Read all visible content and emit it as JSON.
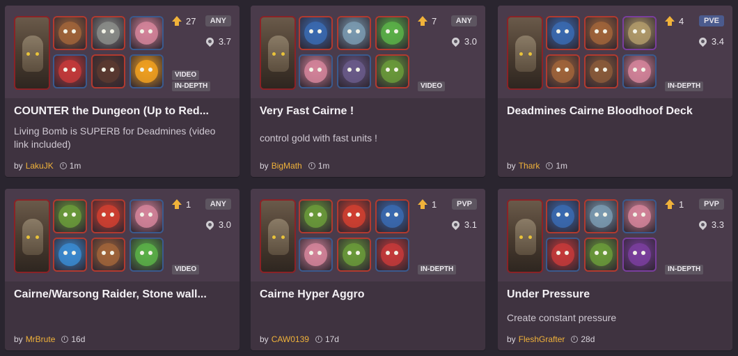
{
  "by_label": "by",
  "cards": [
    {
      "votes": "27",
      "mode": "ANY",
      "elixir": "3.7",
      "tags": [
        "VIDEO",
        "IN-DEPTH"
      ],
      "title": "COUNTER the Dungeon (Up to Red...",
      "description": "Living Bomb is SUPERB for Deadmines (video link included)",
      "author": "LakuJK",
      "age": "1m",
      "units": [
        {
          "name": "ogre-minion",
          "color": "#a0643a",
          "frame": "red"
        },
        {
          "name": "worgen",
          "color": "#8a8c88",
          "frame": "red"
        },
        {
          "name": "pirate-girl",
          "color": "#d4849a",
          "frame": "blue"
        },
        {
          "name": "red-ogre",
          "color": "#c43a3a",
          "frame": "blue"
        },
        {
          "name": "whelp",
          "color": "#5a3a30",
          "frame": "red"
        },
        {
          "name": "fire-elemental",
          "color": "#f0a020",
          "frame": "blue"
        }
      ]
    },
    {
      "votes": "7",
      "mode": "ANY",
      "elixir": "3.0",
      "tags": [
        "VIDEO"
      ],
      "title": "Very Fast Cairne !",
      "description": "control gold with fast units !",
      "author": "BigMath",
      "age": "1m",
      "units": [
        {
          "name": "blue-troll",
          "color": "#3a6ab0",
          "frame": "red"
        },
        {
          "name": "stone-golem",
          "color": "#7a9ab0",
          "frame": "red"
        },
        {
          "name": "murloc",
          "color": "#5ab048",
          "frame": "red"
        },
        {
          "name": "pirate-girl",
          "color": "#d4849a",
          "frame": "blue"
        },
        {
          "name": "bomb",
          "color": "#6a5a8a",
          "frame": "blue"
        },
        {
          "name": "ghoul",
          "color": "#6a9a3a",
          "frame": "red"
        }
      ]
    },
    {
      "votes": "4",
      "mode": "PVE",
      "elixir": "3.4",
      "tags": [
        "IN-DEPTH"
      ],
      "title": "Deadmines Cairne Bloodhoof Deck",
      "description": "",
      "author": "Thark",
      "age": "1m",
      "units": [
        {
          "name": "blue-troll",
          "color": "#3a6ab0",
          "frame": "red"
        },
        {
          "name": "ogre-minion",
          "color": "#a0643a",
          "frame": "red"
        },
        {
          "name": "bone-dwarf",
          "color": "#b09a6a",
          "frame": "purple"
        },
        {
          "name": "rock-golem",
          "color": "#a0643a",
          "frame": "red"
        },
        {
          "name": "boar",
          "color": "#8a5a3a",
          "frame": "red"
        },
        {
          "name": "pirate-girl",
          "color": "#d4849a",
          "frame": "blue"
        }
      ]
    },
    {
      "votes": "1",
      "mode": "ANY",
      "elixir": "3.0",
      "tags": [
        "VIDEO"
      ],
      "title": "Cairne/Warsong Raider, Stone wall...",
      "description": "",
      "author": "MrBrute",
      "age": "16d",
      "units": [
        {
          "name": "orc-grunt",
          "color": "#6a9a3a",
          "frame": "red"
        },
        {
          "name": "fire-breath",
          "color": "#d04030",
          "frame": "red"
        },
        {
          "name": "pirate-girl",
          "color": "#d4849a",
          "frame": "blue"
        },
        {
          "name": "water-elemental",
          "color": "#3a8ad0",
          "frame": "red"
        },
        {
          "name": "boar",
          "color": "#a0643a",
          "frame": "red"
        },
        {
          "name": "murloc",
          "color": "#5ab048",
          "frame": "blue"
        }
      ]
    },
    {
      "votes": "1",
      "mode": "PVP",
      "elixir": "3.1",
      "tags": [
        "IN-DEPTH"
      ],
      "title": "Cairne Hyper Aggro",
      "description": "",
      "author": "CAW0139",
      "age": "17d",
      "units": [
        {
          "name": "ghoul",
          "color": "#6a9a3a",
          "frame": "red"
        },
        {
          "name": "fire-breath",
          "color": "#d04030",
          "frame": "red"
        },
        {
          "name": "blue-troll",
          "color": "#3a6ab0",
          "frame": "red"
        },
        {
          "name": "pirate-girl",
          "color": "#d4849a",
          "frame": "blue"
        },
        {
          "name": "orc-grunt",
          "color": "#6a9a3a",
          "frame": "red"
        },
        {
          "name": "red-ogre",
          "color": "#c43a3a",
          "frame": "blue"
        }
      ]
    },
    {
      "votes": "1",
      "mode": "PVP",
      "elixir": "3.3",
      "tags": [
        "IN-DEPTH"
      ],
      "title": "Under Pressure",
      "description": "Create constant pressure",
      "author": "FleshGrafter",
      "age": "28d",
      "units": [
        {
          "name": "blue-troll",
          "color": "#3a6ab0",
          "frame": "red"
        },
        {
          "name": "stone-golem",
          "color": "#7a9ab0",
          "frame": "red"
        },
        {
          "name": "pirate-girl",
          "color": "#d4849a",
          "frame": "blue"
        },
        {
          "name": "red-ogre",
          "color": "#c43a3a",
          "frame": "blue"
        },
        {
          "name": "ghoul",
          "color": "#6a9a3a",
          "frame": "red"
        },
        {
          "name": "shadow-priest",
          "color": "#7a3e9e",
          "frame": "purple"
        }
      ]
    }
  ]
}
